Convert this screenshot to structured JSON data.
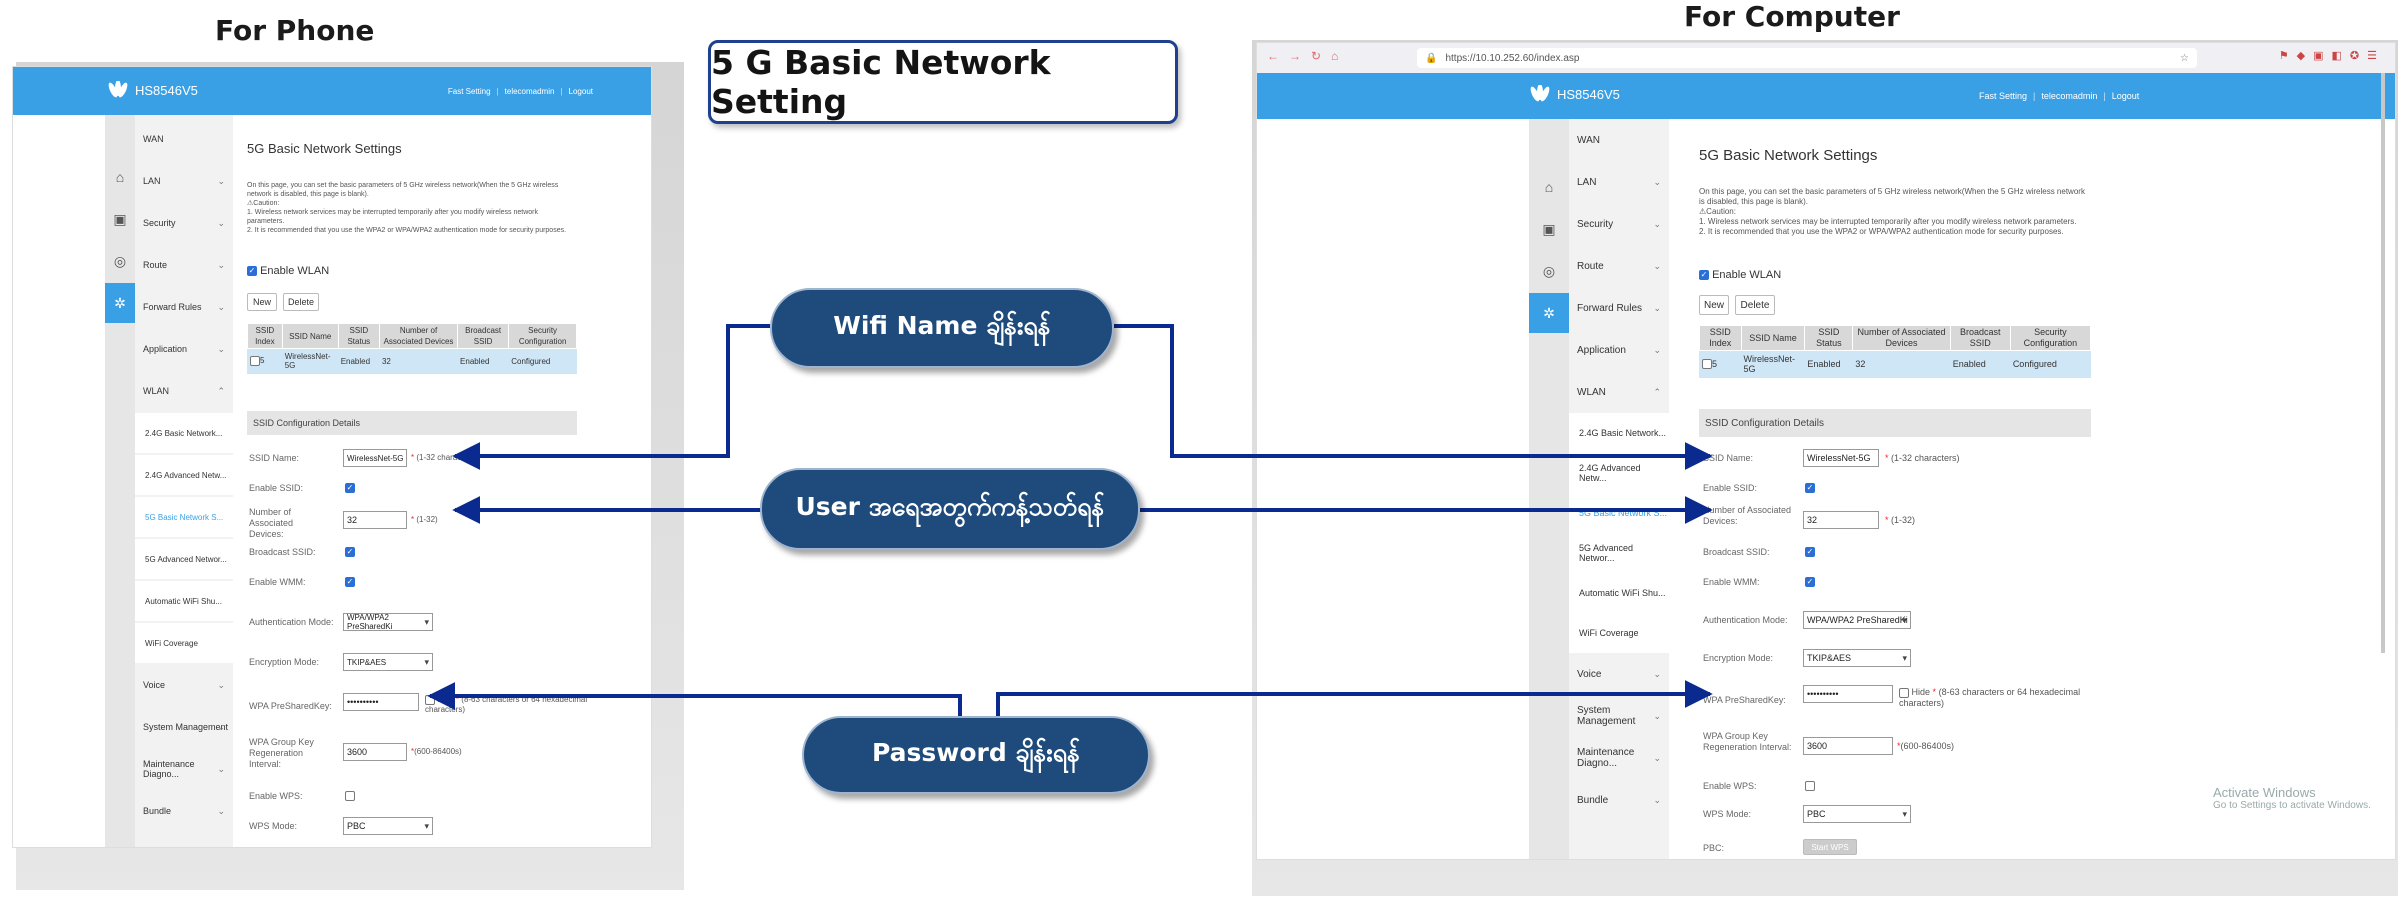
{
  "headings": {
    "phone": "For Phone",
    "computer": "For Computer",
    "title": "5 G Basic Network Setting"
  },
  "callouts": {
    "wifi_name": "Wifi  Name ချိန်းရန်",
    "user_limit": "User အရေအတွက်ကန့်သတ်ရန်",
    "password": "Password ချိန်းရန်"
  },
  "router": {
    "brand": "HS8546V5",
    "links": [
      "Fast Setting",
      "telecomadmin",
      "Logout"
    ],
    "url": "https://10.10.252.60/index.asp",
    "menu": {
      "main": [
        "WAN",
        "LAN",
        "Security",
        "Route",
        "Forward Rules",
        "Application",
        "WLAN"
      ],
      "wlan_sub": [
        "2.4G Basic Network...",
        "2.4G Advanced Netw...",
        "5G Basic Network S...",
        "5G Advanced Networ...",
        "Automatic WiFi Shu...",
        "WiFi Coverage"
      ],
      "after": [
        "Voice",
        "System Management",
        "Maintenance Diagno...",
        "Bundle"
      ]
    },
    "page": {
      "title": "5G Basic Network Settings",
      "desc1": "On this page, you can set the basic parameters of 5 GHz wireless network(When the 5 GHz wireless network is disabled, this page is blank).",
      "caution": "⚠Caution:",
      "desc2": "1. Wireless network services may be interrupted temporarily after you modify wireless network parameters.",
      "desc3": "2. It is recommended that you use the WPA2 or WPA/WPA2 authentication mode for security purposes.",
      "enable_wlan": "Enable WLAN",
      "new_btn": "New",
      "delete_btn": "Delete",
      "table_headers": [
        "SSID Index",
        "SSID Name",
        "SSID Status",
        "Number of Associated Devices",
        "Broadcast SSID",
        "Security Configuration"
      ],
      "table_row": [
        "5",
        "WirelessNet-5G",
        "Enabled",
        "32",
        "Enabled",
        "Configured"
      ],
      "cfg_title": "SSID Configuration Details",
      "fields": {
        "ssid_name_label": "SSID Name:",
        "ssid_name_value": "WirelessNet-5G",
        "ssid_name_note": "(1-32 characters)",
        "enable_ssid_label": "Enable SSID:",
        "assoc_label": "Number of Associated Devices:",
        "assoc_value": "32",
        "assoc_note": "(1-32)",
        "broadcast_label": "Broadcast SSID:",
        "wmm_label": "Enable WMM:",
        "auth_label": "Authentication Mode:",
        "auth_value": "WPA/WPA2 PreSharedKi",
        "enc_label": "Encryption Mode:",
        "enc_value": "TKIP&AES",
        "psk_label": "WPA PreSharedKey:",
        "psk_value": "••••••••••",
        "psk_hide": "Hide",
        "psk_note": "(8-63 characters or 64 hexadecimal characters)",
        "regen_label": "WPA Group Key Regeneration Interval:",
        "regen_value": "3600",
        "regen_note": "(600-86400s)",
        "wps_label": "Enable WPS:",
        "wps_mode_label": "WPS Mode:",
        "wps_mode_value": "PBC",
        "pbc_label": "PBC:",
        "pbc_btn": "Start WPS"
      }
    }
  },
  "watermark": {
    "line1": "Activate Windows",
    "line2": "Go to Settings to activate Windows."
  },
  "colors": {
    "accent": "#3aa0e6",
    "pill": "#1e4b7b",
    "arrow": "#0b2a8f"
  }
}
